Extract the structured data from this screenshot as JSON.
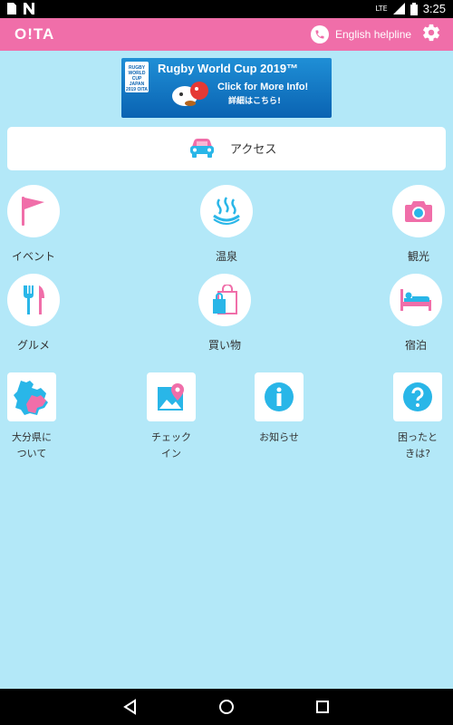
{
  "status_bar": {
    "time": "3:25",
    "network": "LTE",
    "left_icons": [
      "sim-icon",
      "notification-n-icon"
    ]
  },
  "app_bar": {
    "logo": "O!TA",
    "helpline_label": "English helpline",
    "icons": [
      "phone-icon",
      "gear-icon"
    ]
  },
  "banner": {
    "title": "Rugby World Cup 2019™",
    "click_text": "Click for More Info!",
    "jp_text": "詳細はこちら!",
    "badge": "RUGBY WORLD CUP JAPAN 2019 OITA"
  },
  "access": {
    "label": "アクセス",
    "icon": "car-icon"
  },
  "main_menu": [
    {
      "label": "イベント",
      "icon": "flag-icon"
    },
    {
      "label": "温泉",
      "icon": "hot-spring-icon"
    },
    {
      "label": "観光",
      "icon": "camera-icon"
    },
    {
      "label": "グルメ",
      "icon": "cutlery-icon"
    },
    {
      "label": "買い物",
      "icon": "shopping-bag-icon"
    },
    {
      "label": "宿泊",
      "icon": "bed-icon"
    }
  ],
  "sub_menu": [
    {
      "label_line1": "大分県に",
      "label_line2": "ついて",
      "icon": "oita-map-icon"
    },
    {
      "label_line1": "チェック",
      "label_line2": "イン",
      "icon": "map-pin-icon"
    },
    {
      "label_line1": "お知らせ",
      "label_line2": "",
      "icon": "info-icon"
    },
    {
      "label_line1": "困ったと",
      "label_line2": "きは?",
      "icon": "help-icon"
    }
  ],
  "colors": {
    "accent": "#f06ea9",
    "icon_blue": "#29b6e8",
    "background": "#b3e8f8"
  }
}
